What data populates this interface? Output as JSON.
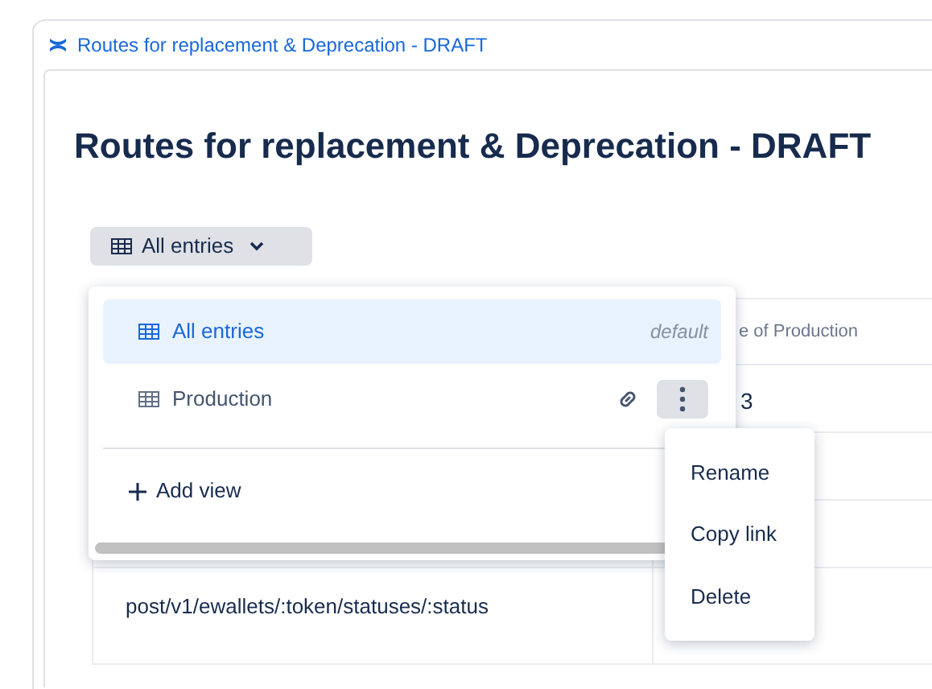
{
  "breadcrumb": {
    "title": "Routes for replacement & Deprecation - DRAFT"
  },
  "page_title": "Routes for replacement & Deprecation - DRAFT",
  "view_button": {
    "label": "All entries"
  },
  "view_menu": {
    "items": [
      {
        "label": "All entries",
        "badge": "default",
        "selected": true,
        "hovered": false
      },
      {
        "label": "Production",
        "selected": false,
        "hovered": true
      }
    ],
    "add_label": "Add view"
  },
  "item_menu": {
    "items": [
      "Rename",
      "Copy link",
      "Delete"
    ]
  },
  "table": {
    "columns": [
      "",
      "e of Production"
    ],
    "rows": [
      [
        "",
        "3"
      ],
      [
        "",
        ""
      ],
      [
        "",
        ""
      ],
      [
        "post/v1/ewallets/:token/statuses/:status",
        ""
      ]
    ]
  }
}
